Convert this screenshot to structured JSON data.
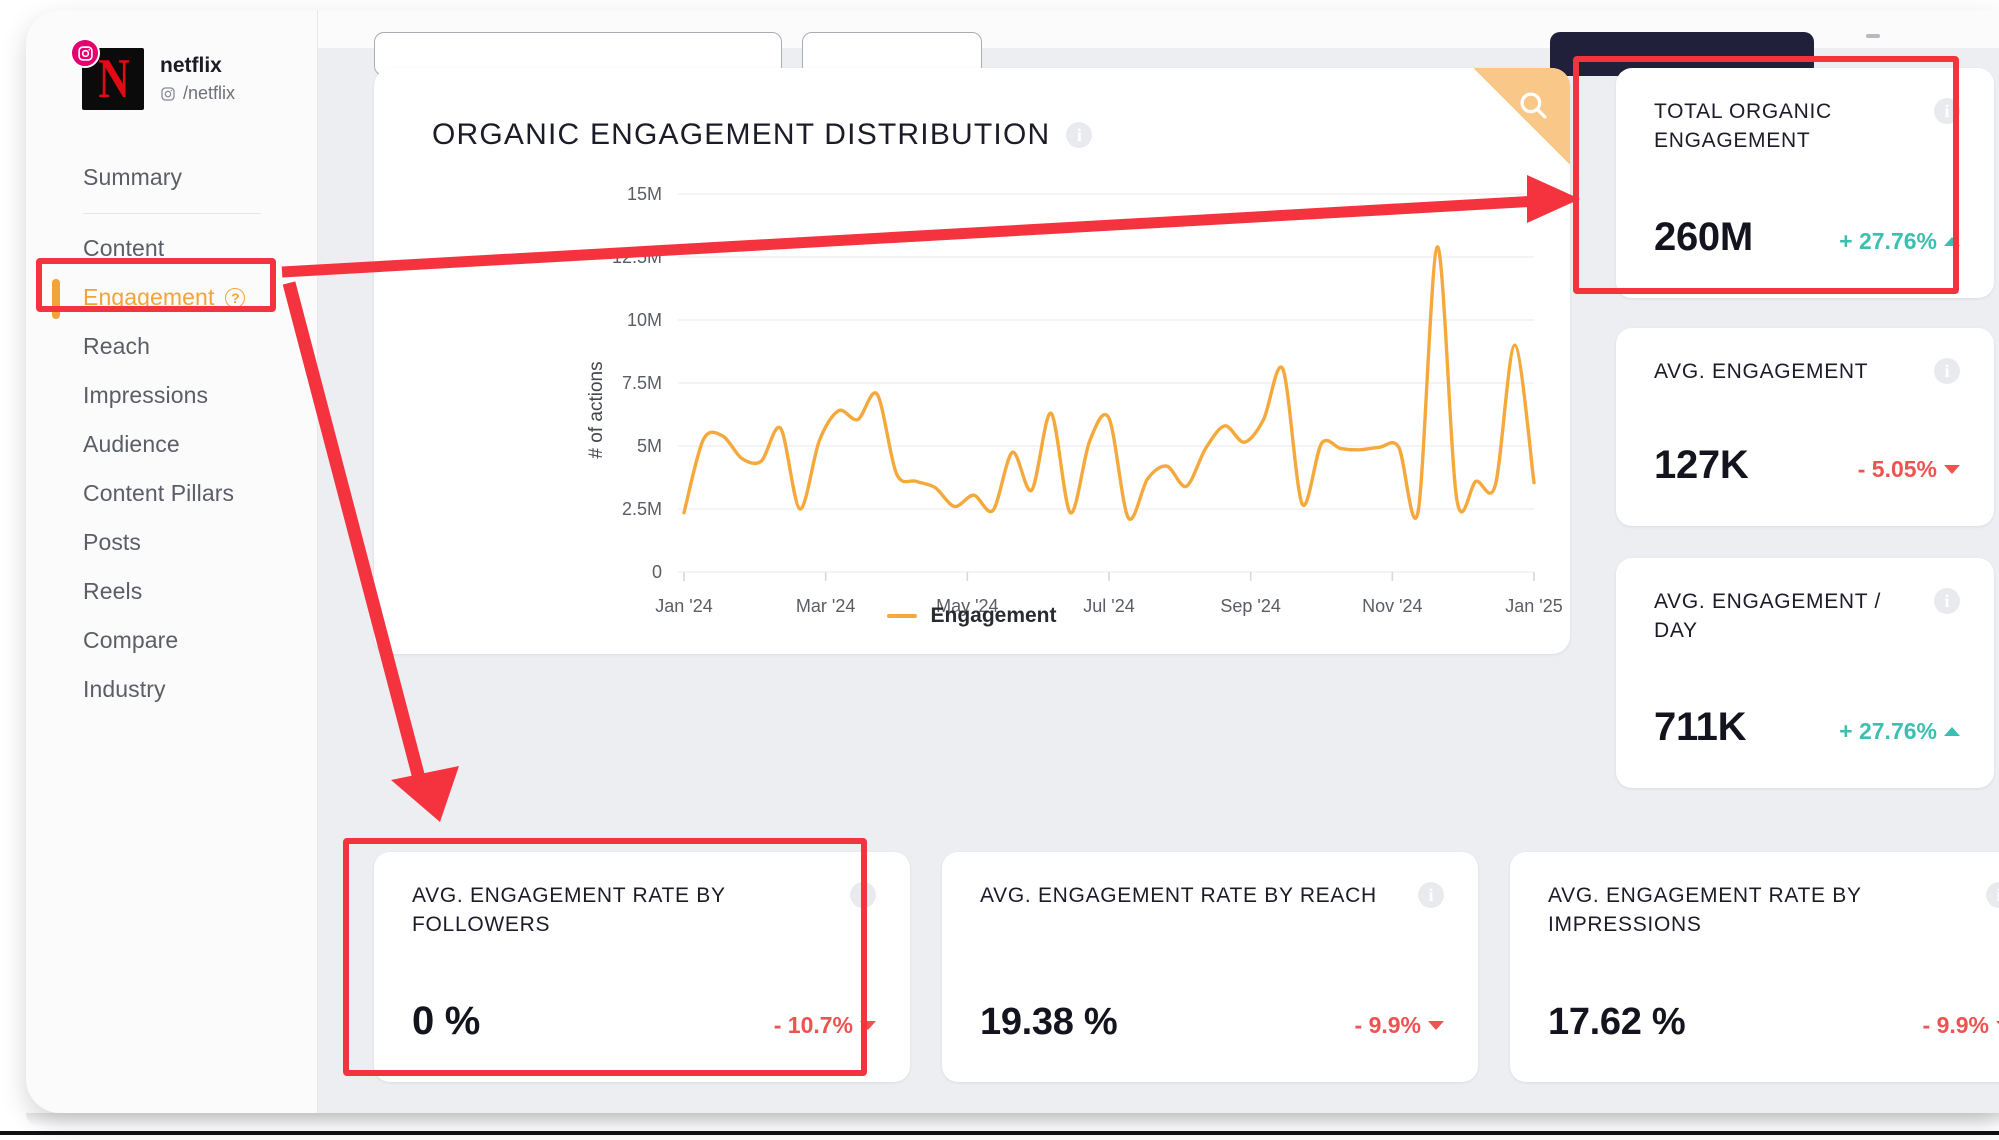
{
  "sidebar": {
    "profile": {
      "name": "netflix",
      "handle": "/netflix",
      "avatar_letter": "N",
      "platform_icon": "instagram-icon"
    },
    "items": [
      {
        "label": "Summary",
        "active": false
      },
      {
        "label": "Content",
        "active": false
      },
      {
        "label": "Engagement",
        "active": true,
        "help_icon": "?"
      },
      {
        "label": "Reach",
        "active": false
      },
      {
        "label": "Impressions",
        "active": false
      },
      {
        "label": "Audience",
        "active": false
      },
      {
        "label": "Content Pillars",
        "active": false
      },
      {
        "label": "Posts",
        "active": false
      },
      {
        "label": "Reels",
        "active": false
      },
      {
        "label": "Compare",
        "active": false
      },
      {
        "label": "Industry",
        "active": false
      }
    ]
  },
  "chart_card": {
    "title": "ORGANIC ENGAGEMENT DISTRIBUTION",
    "info_icon": "info-icon",
    "corner_icon": "search-icon",
    "legend_label": "Engagement"
  },
  "chart_data": {
    "type": "line",
    "title": "ORGANIC ENGAGEMENT DISTRIBUTION",
    "xlabel": "",
    "ylabel": "# of actions",
    "ylim": [
      0,
      15000000
    ],
    "ytick_labels": [
      "0",
      "2.5M",
      "5M",
      "7.5M",
      "10M",
      "12.5M",
      "15M"
    ],
    "ytick_values": [
      0,
      2500000,
      5000000,
      7500000,
      10000000,
      12500000,
      15000000
    ],
    "xtick_labels": [
      "Jan '24",
      "Mar '24",
      "May '24",
      "Jul '24",
      "Sep '24",
      "Nov '24",
      "Jan '25"
    ],
    "grid": true,
    "legend_position": "bottom",
    "series": [
      {
        "name": "Engagement",
        "color": "#f5a93d",
        "values": [
          2350000,
          5250000,
          5400000,
          4500000,
          4400000,
          5700000,
          2500000,
          5200000,
          6400000,
          6050000,
          7050000,
          3900000,
          3600000,
          3350000,
          2600000,
          3050000,
          2450000,
          4750000,
          3250000,
          6300000,
          2350000,
          5200000,
          6100000,
          2150000,
          3700000,
          4200000,
          3400000,
          4900000,
          5800000,
          5150000,
          6050000,
          8050000,
          2700000,
          5100000,
          4900000,
          4850000,
          4950000,
          4950000,
          2400000,
          12900000,
          2900000,
          3600000,
          3450000,
          9000000,
          3550000
        ]
      }
    ]
  },
  "kpi_cards": [
    {
      "title": "TOTAL ORGANIC ENGAGEMENT",
      "value": "260M",
      "delta": "+ 27.76%",
      "direction": "up",
      "info_icon": "info-icon"
    },
    {
      "title": "AVG. ENGAGEMENT",
      "value": "127K",
      "delta": "- 5.05%",
      "direction": "down",
      "info_icon": "info-icon"
    },
    {
      "title": "AVG. ENGAGEMENT / DAY",
      "value": "711K",
      "delta": "+ 27.76%",
      "direction": "up",
      "info_icon": "info-icon"
    },
    {
      "title": "AVG. ENGAGEMENT RATE BY FOLLOWERS",
      "value": "0 %",
      "delta": "- 10.7%",
      "direction": "down",
      "info_icon": "info-icon"
    },
    {
      "title": "AVG. ENGAGEMENT RATE BY REACH",
      "value": "19.38 %",
      "delta": "- 9.9%",
      "direction": "down",
      "info_icon": "info-icon"
    },
    {
      "title": "AVG. ENGAGEMENT RATE BY IMPRESSIONS",
      "value": "17.62 %",
      "delta": "- 9.9%",
      "direction": "down",
      "info_icon": "info-icon"
    }
  ],
  "annotation": {
    "color": "#f5333f",
    "highlight_boxes": [
      "sidebar-item-engagement",
      "total-organic-engagement-card",
      "avg-engagement-rate-by-followers-card"
    ]
  },
  "colors": {
    "accent_orange": "#f1a43a",
    "series_orange": "#f5a93d",
    "positive": "#3bbfb1",
    "negative": "#ef5350",
    "annotation_red": "#f5333f",
    "page_bg": "#eceef1"
  }
}
